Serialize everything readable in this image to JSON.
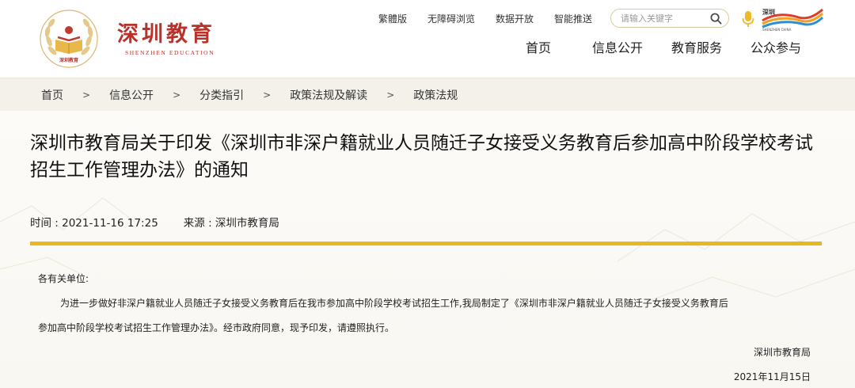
{
  "header": {
    "logo": {
      "cn": "深圳教育",
      "en": "SHENZHEN EDUCATION",
      "emblem_text": "深圳教育"
    },
    "util_links": [
      "繁體版",
      "无障碍浏览",
      "数据开放",
      "智能推送"
    ],
    "search": {
      "placeholder": "请输入关键字"
    },
    "sz_logo_text": "深圳",
    "sz_logo_sub": "SHENZHEN CHINA",
    "nav": [
      "首页",
      "信息公开",
      "教育服务",
      "公众参与"
    ]
  },
  "breadcrumb": [
    "首页",
    "信息公开",
    "分类指引",
    "政策法规及解读",
    "政策法规"
  ],
  "breadcrumb_sep": ">",
  "article": {
    "title": "深圳市教育局关于印发《深圳市非深户籍就业人员随迁子女接受义务教育后参加高中阶段学校考试招生工作管理办法》的通知",
    "time_label": "时间 : 2021-11-16 17:25",
    "source_label": "来源 : 深圳市教育局",
    "salutation": "各有关单位:",
    "para_line1": "为进一步做好非深户籍就业人员随迁子女接受义务教育后在我市参加高中阶段学校考试招生工作,我局制定了《深圳市非深户籍就业人员随迁子女接受义务教育后",
    "para_line2": "参加高中阶段学校考试招生工作管理办法》。经市政府同意，现予印发，请遵照执行。",
    "signature": "深圳市教育局",
    "date": "2021年11月15日"
  },
  "colors": {
    "brand_red": "#b8322a",
    "gold": "#e8b81c",
    "breadcrumb_bg": "#f4f1ea"
  }
}
